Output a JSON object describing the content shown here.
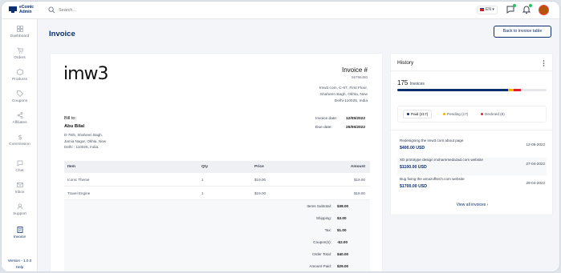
{
  "app": {
    "logo_line1": "eComic",
    "logo_line2": "Admin"
  },
  "search": {
    "placeholder": "Search..."
  },
  "topbar": {
    "language": "EN"
  },
  "sidebar": {
    "items": [
      {
        "label": "Dashboard",
        "icon": "dashboard-icon"
      },
      {
        "label": "Orders",
        "icon": "cart-icon"
      },
      {
        "label": "Products",
        "icon": "box-icon"
      },
      {
        "label": "Coupons",
        "icon": "tag-icon"
      },
      {
        "label": "Affiliates",
        "icon": "share-icon"
      },
      {
        "label": "Commission",
        "icon": "dollar-icon"
      },
      {
        "label": "Chat",
        "icon": "chat-icon"
      },
      {
        "label": "Inbox",
        "icon": "mail-icon"
      },
      {
        "label": "Support",
        "icon": "person-icon"
      },
      {
        "label": "Invoice",
        "icon": "invoice-icon"
      }
    ],
    "version": "Version - 1.0.0",
    "help": "Help"
  },
  "page": {
    "title": "Invoice",
    "back_button": "Back to invoice table"
  },
  "invoice": {
    "brand": "imw3",
    "title": "Invoice #",
    "number": "56796480",
    "company_address": "Imw3.com, C-67, First Floor,\nShaheen Bagh, Okhla, New\nDelhi-110025, India",
    "bill_to_label": "Bill to:",
    "bill_to_name": "Abu Bilal",
    "bill_to_address": "D-78/5, Shaheen Bagh,\nJamia Nagar, Okhla, New\nDelhi - 110025, India.",
    "invoice_date_label": "Invoice date:",
    "invoice_date": "12/05/2022",
    "due_date_label": "Due date:",
    "due_date": "25/05/2022",
    "columns": [
      "Item",
      "Qty",
      "Price",
      "Amount"
    ],
    "rows": [
      {
        "item": "Iconic Theme",
        "qty": "1",
        "price": "$19.00",
        "amount": "$19.00"
      },
      {
        "item": "Travel Engine",
        "qty": "1",
        "price": "$19.00",
        "amount": "$19.00"
      }
    ],
    "summary": [
      {
        "label": "Items Subtotal:",
        "value": "$38.00"
      },
      {
        "label": "Shipping:",
        "value": "$3.00"
      },
      {
        "label": "Tax:",
        "value": "$1.00"
      },
      {
        "label": "Coupon(s):",
        "value": "-$2.00"
      },
      {
        "label": "Order Total:",
        "value": "$40.00"
      },
      {
        "label": "Amount Paid:",
        "value": "$29.00"
      }
    ]
  },
  "history": {
    "title": "History",
    "count": "175",
    "count_label": "Invoices",
    "progress": {
      "paid": 0.74,
      "pending": 0.04,
      "declined": 0.05
    },
    "colors": {
      "paid": "#0b2e6f",
      "pending": "#f5b301",
      "declined": "#e11d2e"
    },
    "tabs": [
      {
        "label": "Paid (217)"
      },
      {
        "label": "Pending (17)"
      },
      {
        "label": "Declined (8)"
      }
    ],
    "items": [
      {
        "title": "Redesigning the imw3.com about page",
        "amount": "$400.00 USD",
        "date": "12-05-2022"
      },
      {
        "title": "XD prototype design mohammedazad.com website",
        "amount": "$1100.00 USD",
        "date": "27-04-2022"
      },
      {
        "title": "Bug fixing the amazofltech.com website",
        "amount": "$1700.00 USD",
        "date": "29-04-2022"
      }
    ],
    "view_all": "View all invoices"
  }
}
